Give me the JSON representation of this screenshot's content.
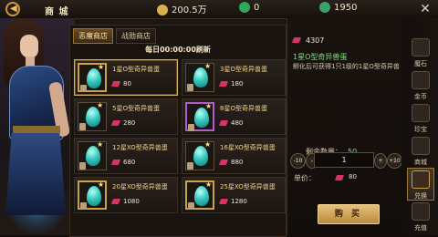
{
  "header": {
    "title": "商 城",
    "resources": [
      {
        "icon": "gold-coin-icon",
        "value": "200.5万",
        "color": "#d9b34a"
      },
      {
        "icon": "green-coin-icon",
        "value": "0",
        "color": "#2fa85a"
      },
      {
        "icon": "green-gem-coin-icon",
        "value": "1950",
        "color": "#3aa36a"
      }
    ]
  },
  "tabs": [
    {
      "label": "恶魔商店",
      "active": true
    },
    {
      "label": "战勋商店",
      "active": false
    }
  ],
  "refresh_text": "每日00:00:00刷新",
  "items": [
    {
      "name": "1星O型奇异兽蛋",
      "price": "80",
      "rarity": "gold",
      "selected": true
    },
    {
      "name": "3星O型奇异兽蛋",
      "price": "180",
      "rarity": "gray",
      "selected": false
    },
    {
      "name": "5星O型奇异兽蛋",
      "price": "280",
      "rarity": "gray",
      "selected": false
    },
    {
      "name": "8星O型奇异兽蛋",
      "price": "480",
      "rarity": "purple",
      "selected": false
    },
    {
      "name": "12星XO型奇异兽蛋",
      "price": "680",
      "rarity": "gray",
      "selected": false
    },
    {
      "name": "16星XO型奇异兽蛋",
      "price": "880",
      "rarity": "gray",
      "selected": false
    },
    {
      "name": "20星XO型奇异兽蛋",
      "price": "1080",
      "rarity": "gold",
      "selected": false
    },
    {
      "name": "25星XO型奇异兽蛋",
      "price": "1280",
      "rarity": "gold",
      "selected": false
    }
  ],
  "detail": {
    "balance": "4307",
    "name": "1星O型奇异兽蛋",
    "description": "孵化后可获得1只1级的1星O型奇异兽",
    "remain_label": "剩余数量：",
    "remain_value": "50",
    "minus10": "-10",
    "minus": "-",
    "qty": "1",
    "plus": "+",
    "plus10": "+10",
    "unit_label": "单价：",
    "unit_price": "80",
    "buy_label": "购 买"
  },
  "sidenav": [
    {
      "label": "魔石",
      "icon": "magic-stone-icon",
      "active": false
    },
    {
      "label": "金币",
      "icon": "coin-icon",
      "active": false
    },
    {
      "label": "珍宝",
      "icon": "treasure-icon",
      "active": false
    },
    {
      "label": "商城",
      "icon": "shop-icon",
      "active": false
    },
    {
      "label": "兑换",
      "icon": "exchange-icon",
      "active": true
    },
    {
      "label": "充值",
      "icon": "recharge-icon",
      "active": false
    }
  ],
  "colors": {
    "accent": "#d8b25a",
    "gem": "#d8326a",
    "highlight": "#7fe07a"
  }
}
